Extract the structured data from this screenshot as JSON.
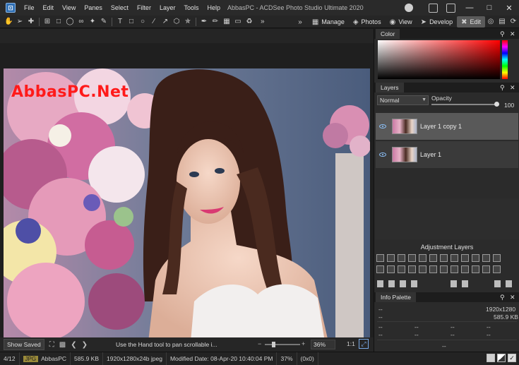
{
  "window": {
    "title": "AbbasPC - ACDSee Photo Studio Ultimate 2020",
    "logo_glyph": "⊡"
  },
  "menu": [
    "File",
    "Edit",
    "View",
    "Panes",
    "Select",
    "Filter",
    "Layer",
    "Tools",
    "Help"
  ],
  "modes": {
    "manage": "Manage",
    "photos": "Photos",
    "view": "View",
    "develop": "Develop",
    "edit": "Edit",
    "active": "Edit"
  },
  "canvas": {
    "watermark": "AbbasPC.Net",
    "show_saved": "Show Saved",
    "hint": "Use the Hand tool to pan scrollable i...",
    "zoom": "36%",
    "ratio": "1:1"
  },
  "status": {
    "index": "4/12",
    "format": "JPG",
    "name": "AbbasPC",
    "size": "585.9 KB",
    "dimensions": "1920x1280x24b jpeg",
    "modified": "Modified Date: 08-Apr-20 10:40:04 PM",
    "zoom": "37%",
    "coords": "(0x0)"
  },
  "panels": {
    "color": {
      "title": "Color"
    },
    "layers": {
      "title": "Layers",
      "blend_mode": "Normal",
      "opacity_label": "Opacity",
      "opacity_value": "100",
      "items": [
        {
          "name": "Layer 1 copy 1",
          "selected": true
        },
        {
          "name": "Layer 1",
          "selected": false
        }
      ]
    },
    "adjustment": {
      "title": "Adjustment Layers"
    },
    "info": {
      "title": "Info Palette",
      "dimensions": "1920x1280",
      "size": "585.9 KB",
      "placeholder": "--"
    }
  }
}
